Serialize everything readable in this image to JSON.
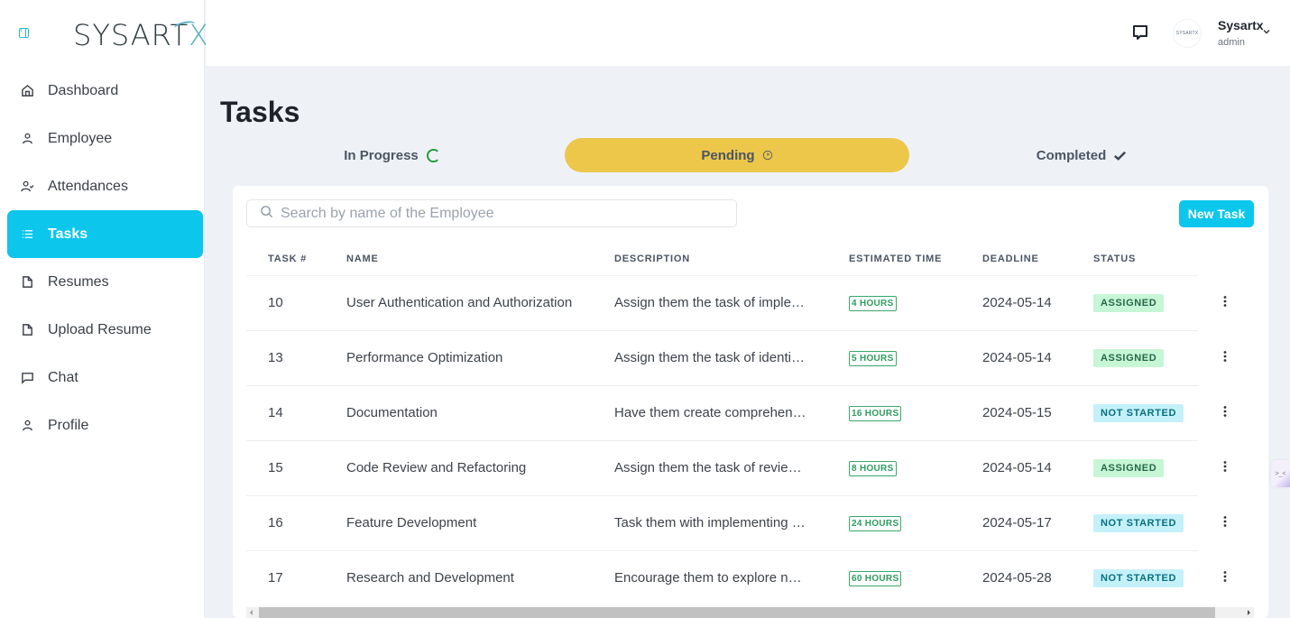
{
  "brand": {
    "logo_text": "SYSART",
    "logo_accent": "X"
  },
  "sidebar": {
    "collapse_icon": "collapse-sidebar-icon",
    "active_color": "#0cc6ec",
    "items": [
      {
        "label": "Dashboard",
        "icon": "home-icon",
        "active": false
      },
      {
        "label": "Employee",
        "icon": "user-icon",
        "active": false
      },
      {
        "label": "Attendances",
        "icon": "user-check-icon",
        "active": false
      },
      {
        "label": "Tasks",
        "icon": "list-icon",
        "active": true
      },
      {
        "label": "Resumes",
        "icon": "file-icon",
        "active": false
      },
      {
        "label": "Upload Resume",
        "icon": "file-icon",
        "active": false
      },
      {
        "label": "Chat",
        "icon": "chat-icon",
        "active": false
      },
      {
        "label": "Profile",
        "icon": "user-icon",
        "active": false
      }
    ]
  },
  "header": {
    "chat_icon": "message-square-icon",
    "avatar_text": "SYSARTX",
    "user_name": "Sysartx",
    "user_role": "admin"
  },
  "main": {
    "title": "Tasks",
    "tabs": [
      {
        "label": "In Progress",
        "icon": "spinner-icon",
        "active": false
      },
      {
        "label": "Pending",
        "icon": "clock-icon",
        "active": true
      },
      {
        "label": "Completed",
        "icon": "check-icon",
        "active": false
      }
    ],
    "search": {
      "placeholder": "Search by name of the Employee",
      "value": ""
    },
    "new_task_label": "New Task",
    "table": {
      "headers": [
        "TASK #",
        "NAME",
        "DESCRIPTION",
        "ESTIMATED TIME",
        "DEADLINE",
        "STATUS"
      ],
      "rows": [
        {
          "id": "10",
          "name": "User Authentication and Authorization",
          "description": "Assign them the task of imple…",
          "estimated": "4 HOURS",
          "deadline": "2024-05-14",
          "status": "ASSIGNED"
        },
        {
          "id": "13",
          "name": "Performance Optimization",
          "description": "Assign them the task of identi…",
          "estimated": "5 HOURS",
          "deadline": "2024-05-14",
          "status": "ASSIGNED"
        },
        {
          "id": "14",
          "name": "Documentation",
          "description": "Have them create comprehen…",
          "estimated": "16 HOURS",
          "deadline": "2024-05-15",
          "status": "NOT STARTED"
        },
        {
          "id": "15",
          "name": "Code Review and Refactoring",
          "description": "Assign them the task of revie…",
          "estimated": "8 HOURS",
          "deadline": "2024-05-14",
          "status": "ASSIGNED"
        },
        {
          "id": "16",
          "name": "Feature Development",
          "description": "Task them with implementing …",
          "estimated": "24 HOURS",
          "deadline": "2024-05-17",
          "status": "NOT STARTED"
        },
        {
          "id": "17",
          "name": "Research and Development",
          "description": "Encourage them to explore n…",
          "estimated": "60 HOURS",
          "deadline": "2024-05-28",
          "status": "NOT STARTED"
        }
      ]
    }
  },
  "floating_widget": {
    "text": ">_<"
  }
}
